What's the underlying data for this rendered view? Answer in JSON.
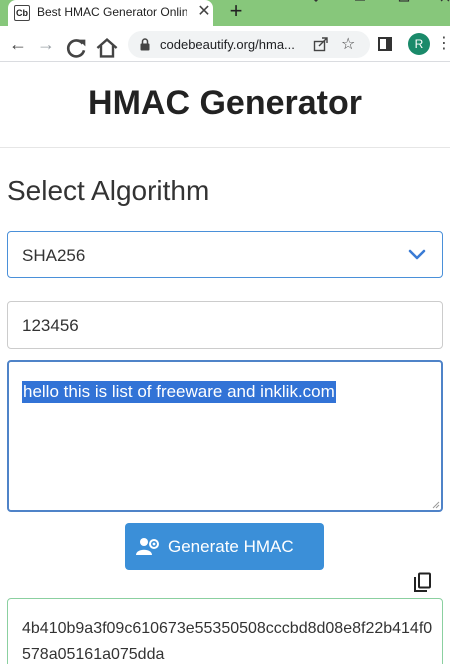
{
  "browser": {
    "tab": {
      "favicon_text": "Cb",
      "title": "Best HMAC Generator Online",
      "close_glyph": "✕"
    },
    "new_tab_glyph": "+",
    "nav": {
      "back_glyph": "←",
      "forward_glyph": "→",
      "reload_glyph": "C",
      "home_glyph": "⌂"
    },
    "address": {
      "url": "codebeautify.org/hma..."
    },
    "star_glyph": "☆",
    "profile_initial": "R",
    "menu_glyph": "⋮",
    "accent_color": "#87c77b"
  },
  "page": {
    "title": "HMAC Generator",
    "algorithm_section_title": "Select Algorithm",
    "algorithm_select": {
      "selected": "SHA256"
    },
    "key_input": {
      "value": "123456"
    },
    "message_textarea": {
      "value": "hello this is list of freeware and inklik.com",
      "selected": true
    },
    "generate_button": {
      "label": "Generate HMAC",
      "color": "#3b8fd8"
    },
    "output": {
      "value": "4b410b9a3f09c610673e55350508cccbd8d08e8f22b414f0578a05161a075dda"
    }
  }
}
